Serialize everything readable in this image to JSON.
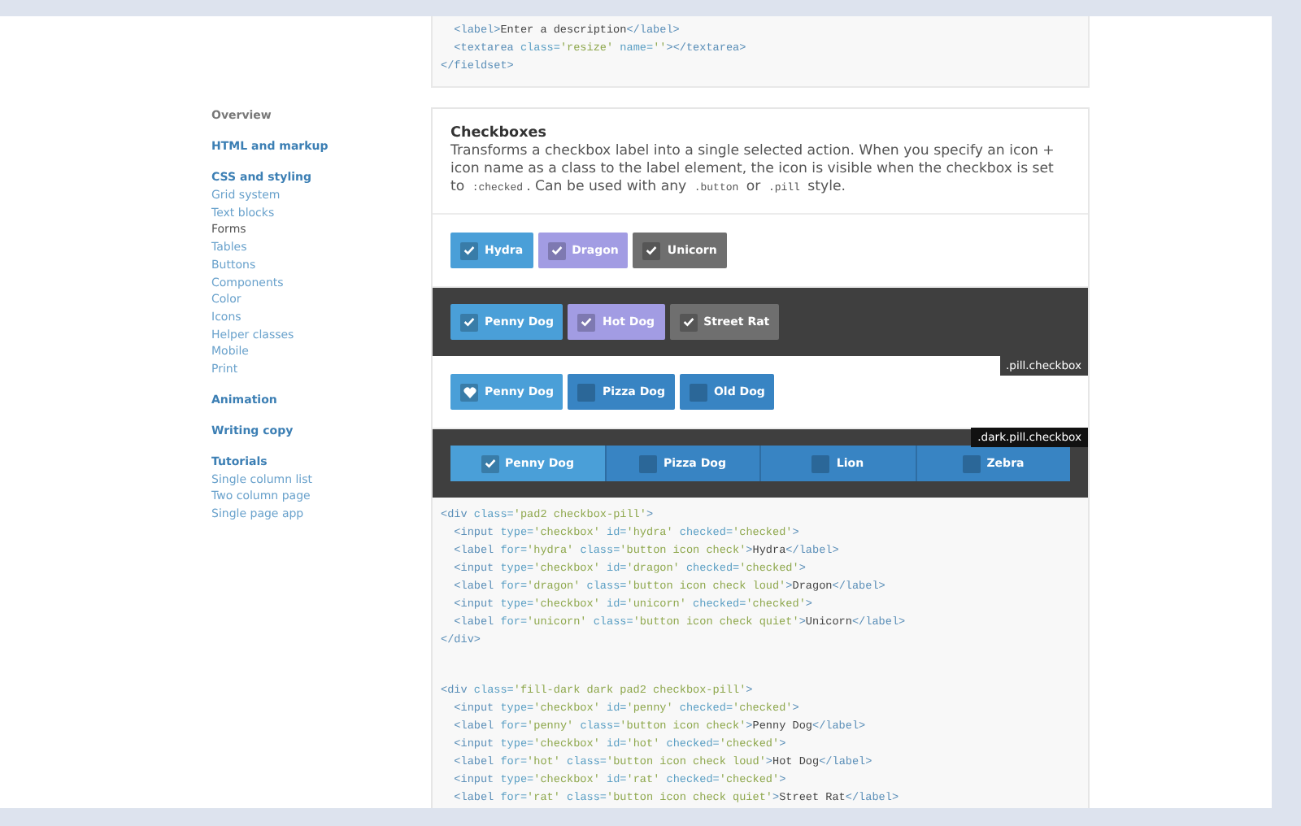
{
  "sidebar": [
    {
      "title": "Overview",
      "kind": "home"
    },
    {
      "title": "HTML and markup",
      "kind": "group"
    },
    {
      "title": "CSS and styling",
      "kind": "group",
      "children": [
        {
          "label": "Grid system",
          "selected": false
        },
        {
          "label": "Text blocks",
          "selected": false
        },
        {
          "label": "Forms",
          "selected": true
        },
        {
          "label": "Tables",
          "selected": false
        },
        {
          "label": "Buttons",
          "selected": false
        },
        {
          "label": "Components",
          "selected": false
        },
        {
          "label": "Color",
          "selected": false
        },
        {
          "label": "Icons",
          "selected": false
        },
        {
          "label": "Helper classes",
          "selected": false
        },
        {
          "label": "Mobile",
          "selected": false
        },
        {
          "label": "Print",
          "selected": false
        }
      ]
    },
    {
      "title": "Animation",
      "kind": "group"
    },
    {
      "title": "Writing copy",
      "kind": "group"
    },
    {
      "title": "Tutorials",
      "kind": "group",
      "children": [
        {
          "label": "Single column list",
          "selected": false
        },
        {
          "label": "Two column page",
          "selected": false
        },
        {
          "label": "Single page app",
          "selected": false
        }
      ]
    }
  ],
  "top_code": [
    [
      {
        "kind": "tag",
        "text": "  <label>"
      },
      {
        "kind": "content",
        "text": "Enter a description"
      },
      {
        "kind": "tag",
        "text": "</label>"
      }
    ],
    [
      {
        "kind": "tag",
        "text": "  <textarea "
      },
      {
        "kind": "attr",
        "text": "class="
      },
      {
        "kind": "value",
        "text": "'resize' "
      },
      {
        "kind": "attr",
        "text": "name="
      },
      {
        "kind": "value",
        "text": "''"
      },
      {
        "kind": "tag",
        "text": "></textarea>"
      }
    ],
    [
      {
        "kind": "tag",
        "text": "</fieldset>"
      }
    ]
  ],
  "section": {
    "title": "Checkboxes",
    "description": [
      {
        "kind": "prose",
        "text": "Transforms a checkbox label into a single selected action. When you specify an icon + icon name as a class to the label element, the icon is visible when the checkbox is set to "
      },
      {
        "kind": "code",
        "text": ":checked"
      },
      {
        "kind": "prose",
        "text": ". Can be used with any "
      },
      {
        "kind": "code",
        "text": ".button"
      },
      {
        "kind": "prose",
        "text": " or "
      },
      {
        "kind": "code",
        "text": ".pill"
      },
      {
        "kind": "prose",
        "text": " style."
      }
    ]
  },
  "demo_rows": [
    {
      "kind": "light",
      "items": [
        {
          "label": "Hydra",
          "checked": true,
          "kind": "primary"
        },
        {
          "label": "Dragon",
          "checked": true,
          "kind": "loud"
        },
        {
          "label": "Unicorn",
          "checked": true,
          "kind": "quiet"
        }
      ]
    },
    {
      "kind": "dark",
      "items": [
        {
          "label": "Penny Dog",
          "checked": true,
          "kind": "primary"
        },
        {
          "label": "Hot Dog",
          "checked": true,
          "kind": "loud"
        },
        {
          "label": "Street Rat",
          "checked": true,
          "kind": "quiet"
        }
      ]
    },
    {
      "kind": "light",
      "tag": ".pill.checkbox",
      "items": [
        {
          "label": "Penny Dog",
          "checked": true,
          "kind": "heart"
        },
        {
          "label": "Pizza Dog",
          "checked": false,
          "kind": "heart"
        },
        {
          "label": "Old Dog",
          "checked": false,
          "kind": "heart"
        }
      ]
    },
    {
      "kind": "dark-segmented",
      "tag": ".dark.pill.checkbox",
      "items": [
        {
          "label": "Penny Dog",
          "checked": true,
          "kind": "primary"
        },
        {
          "label": "Pizza Dog",
          "checked": false,
          "kind": "primary"
        },
        {
          "label": "Lion",
          "checked": false,
          "kind": "primary"
        },
        {
          "label": "Zebra",
          "checked": false,
          "kind": "primary"
        }
      ]
    }
  ],
  "code_blocks": [
    [
      [
        {
          "kind": "tag",
          "text": "<div "
        },
        {
          "kind": "attr",
          "text": "class="
        },
        {
          "kind": "value",
          "text": "'pad2 checkbox-pill'"
        },
        {
          "kind": "tag",
          "text": ">"
        }
      ],
      [
        {
          "kind": "tag",
          "text": "  <input "
        },
        {
          "kind": "attr",
          "text": "type="
        },
        {
          "kind": "value",
          "text": "'checkbox' "
        },
        {
          "kind": "attr",
          "text": "id="
        },
        {
          "kind": "value",
          "text": "'hydra' "
        },
        {
          "kind": "attr",
          "text": "checked="
        },
        {
          "kind": "value",
          "text": "'checked'"
        },
        {
          "kind": "tag",
          "text": ">"
        }
      ],
      [
        {
          "kind": "tag",
          "text": "  <label "
        },
        {
          "kind": "attr",
          "text": "for="
        },
        {
          "kind": "value",
          "text": "'hydra' "
        },
        {
          "kind": "attr",
          "text": "class="
        },
        {
          "kind": "value",
          "text": "'button icon check'"
        },
        {
          "kind": "tag",
          "text": ">"
        },
        {
          "kind": "content",
          "text": "Hydra"
        },
        {
          "kind": "tag",
          "text": "</label>"
        }
      ],
      [
        {
          "kind": "tag",
          "text": "  <input "
        },
        {
          "kind": "attr",
          "text": "type="
        },
        {
          "kind": "value",
          "text": "'checkbox' "
        },
        {
          "kind": "attr",
          "text": "id="
        },
        {
          "kind": "value",
          "text": "'dragon' "
        },
        {
          "kind": "attr",
          "text": "checked="
        },
        {
          "kind": "value",
          "text": "'checked'"
        },
        {
          "kind": "tag",
          "text": ">"
        }
      ],
      [
        {
          "kind": "tag",
          "text": "  <label "
        },
        {
          "kind": "attr",
          "text": "for="
        },
        {
          "kind": "value",
          "text": "'dragon' "
        },
        {
          "kind": "attr",
          "text": "class="
        },
        {
          "kind": "value",
          "text": "'button icon check loud'"
        },
        {
          "kind": "tag",
          "text": ">"
        },
        {
          "kind": "content",
          "text": "Dragon"
        },
        {
          "kind": "tag",
          "text": "</label>"
        }
      ],
      [
        {
          "kind": "tag",
          "text": "  <input "
        },
        {
          "kind": "attr",
          "text": "type="
        },
        {
          "kind": "value",
          "text": "'checkbox' "
        },
        {
          "kind": "attr",
          "text": "id="
        },
        {
          "kind": "value",
          "text": "'unicorn' "
        },
        {
          "kind": "attr",
          "text": "checked="
        },
        {
          "kind": "value",
          "text": "'checked'"
        },
        {
          "kind": "tag",
          "text": ">"
        }
      ],
      [
        {
          "kind": "tag",
          "text": "  <label "
        },
        {
          "kind": "attr",
          "text": "for="
        },
        {
          "kind": "value",
          "text": "'unicorn' "
        },
        {
          "kind": "attr",
          "text": "class="
        },
        {
          "kind": "value",
          "text": "'button icon check quiet'"
        },
        {
          "kind": "tag",
          "text": ">"
        },
        {
          "kind": "content",
          "text": "Unicorn"
        },
        {
          "kind": "tag",
          "text": "</label>"
        }
      ],
      [
        {
          "kind": "tag",
          "text": "</div>"
        }
      ]
    ],
    [
      [
        {
          "kind": "tag",
          "text": "<div "
        },
        {
          "kind": "attr",
          "text": "class="
        },
        {
          "kind": "value",
          "text": "'fill-dark dark pad2 checkbox-pill'"
        },
        {
          "kind": "tag",
          "text": ">"
        }
      ],
      [
        {
          "kind": "tag",
          "text": "  <input "
        },
        {
          "kind": "attr",
          "text": "type="
        },
        {
          "kind": "value",
          "text": "'checkbox' "
        },
        {
          "kind": "attr",
          "text": "id="
        },
        {
          "kind": "value",
          "text": "'penny' "
        },
        {
          "kind": "attr",
          "text": "checked="
        },
        {
          "kind": "value",
          "text": "'checked'"
        },
        {
          "kind": "tag",
          "text": ">"
        }
      ],
      [
        {
          "kind": "tag",
          "text": "  <label "
        },
        {
          "kind": "attr",
          "text": "for="
        },
        {
          "kind": "value",
          "text": "'penny' "
        },
        {
          "kind": "attr",
          "text": "class="
        },
        {
          "kind": "value",
          "text": "'button icon check'"
        },
        {
          "kind": "tag",
          "text": ">"
        },
        {
          "kind": "content",
          "text": "Penny Dog"
        },
        {
          "kind": "tag",
          "text": "</label>"
        }
      ],
      [
        {
          "kind": "tag",
          "text": "  <input "
        },
        {
          "kind": "attr",
          "text": "type="
        },
        {
          "kind": "value",
          "text": "'checkbox' "
        },
        {
          "kind": "attr",
          "text": "id="
        },
        {
          "kind": "value",
          "text": "'hot' "
        },
        {
          "kind": "attr",
          "text": "checked="
        },
        {
          "kind": "value",
          "text": "'checked'"
        },
        {
          "kind": "tag",
          "text": ">"
        }
      ],
      [
        {
          "kind": "tag",
          "text": "  <label "
        },
        {
          "kind": "attr",
          "text": "for="
        },
        {
          "kind": "value",
          "text": "'hot' "
        },
        {
          "kind": "attr",
          "text": "class="
        },
        {
          "kind": "value",
          "text": "'button icon check loud'"
        },
        {
          "kind": "tag",
          "text": ">"
        },
        {
          "kind": "content",
          "text": "Hot Dog"
        },
        {
          "kind": "tag",
          "text": "</label>"
        }
      ],
      [
        {
          "kind": "tag",
          "text": "  <input "
        },
        {
          "kind": "attr",
          "text": "type="
        },
        {
          "kind": "value",
          "text": "'checkbox' "
        },
        {
          "kind": "attr",
          "text": "id="
        },
        {
          "kind": "value",
          "text": "'rat' "
        },
        {
          "kind": "attr",
          "text": "checked="
        },
        {
          "kind": "value",
          "text": "'checked'"
        },
        {
          "kind": "tag",
          "text": ">"
        }
      ],
      [
        {
          "kind": "tag",
          "text": "  <label "
        },
        {
          "kind": "attr",
          "text": "for="
        },
        {
          "kind": "value",
          "text": "'rat' "
        },
        {
          "kind": "attr",
          "text": "class="
        },
        {
          "kind": "value",
          "text": "'button icon check quiet'"
        },
        {
          "kind": "tag",
          "text": ">"
        },
        {
          "kind": "content",
          "text": "Street Rat"
        },
        {
          "kind": "tag",
          "text": "</label>"
        }
      ]
    ]
  ]
}
